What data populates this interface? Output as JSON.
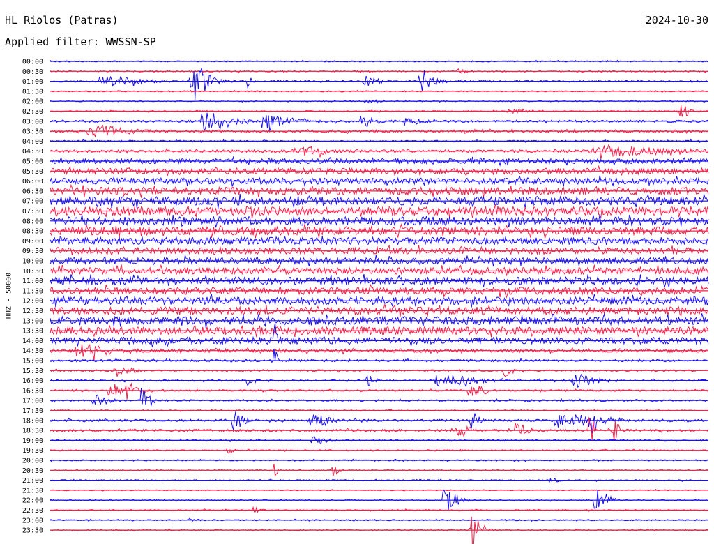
{
  "header": {
    "station": "HL Riolos (Patras)",
    "date": "2024-10-30",
    "filter": "Applied filter: WWSSN-SP"
  },
  "colors": {
    "traceA": "#1a10f0",
    "traceB": "#f0204a",
    "text": "#000000"
  },
  "chart_data": {
    "type": "line",
    "title": "HL Riolos (Patras)",
    "subtitle": "Applied filter: WWSSN-SP",
    "ylabel": "HHZ - 50000",
    "xlabel": "",
    "grid": false,
    "row_labels": [
      "00:00",
      "00:30",
      "01:00",
      "01:30",
      "02:00",
      "02:30",
      "03:00",
      "03:30",
      "04:00",
      "04:30",
      "05:00",
      "05:30",
      "06:00",
      "06:30",
      "07:00",
      "07:30",
      "08:00",
      "08:30",
      "09:00",
      "09:30",
      "10:00",
      "10:30",
      "11:00",
      "11:30",
      "12:00",
      "12:30",
      "13:00",
      "13:30",
      "14:00",
      "14:30",
      "15:00",
      "15:30",
      "16:00",
      "16:30",
      "17:00",
      "17:30",
      "18:00",
      "18:30",
      "19:00",
      "19:30",
      "20:00",
      "20:30",
      "21:00",
      "21:30",
      "22:00",
      "22:30",
      "23:00",
      "23:30"
    ],
    "series": [
      {
        "color": "blue",
        "rows": [
          0,
          2,
          4,
          6,
          8,
          10,
          12,
          14,
          16,
          18,
          20,
          22,
          24,
          26,
          28,
          30,
          32,
          34,
          36,
          38,
          40,
          42,
          44,
          46
        ]
      },
      {
        "color": "red",
        "rows": [
          1,
          3,
          5,
          7,
          9,
          11,
          13,
          15,
          17,
          19,
          21,
          23,
          25,
          27,
          29,
          31,
          33,
          35,
          37,
          39,
          41,
          43,
          45,
          47
        ]
      }
    ],
    "noise_level": [
      0.15,
      0.15,
      0.2,
      0.15,
      0.12,
      0.15,
      0.25,
      0.3,
      0.2,
      0.3,
      0.55,
      0.65,
      0.7,
      0.85,
      0.95,
      0.95,
      0.95,
      0.9,
      0.8,
      0.7,
      0.7,
      0.75,
      0.85,
      0.8,
      0.85,
      0.85,
      0.9,
      0.85,
      0.75,
      0.4,
      0.25,
      0.2,
      0.2,
      0.2,
      0.2,
      0.15,
      0.25,
      0.25,
      0.2,
      0.15,
      0.15,
      0.15,
      0.15,
      0.12,
      0.15,
      0.15,
      0.15,
      0.15
    ],
    "events": [
      {
        "row": 1,
        "t": 0.62,
        "amp": 0.2,
        "width": 0.01
      },
      {
        "row": 2,
        "t": 0.09,
        "amp": 0.4,
        "width": 0.05
      },
      {
        "row": 2,
        "t": 0.22,
        "amp": 0.45,
        "width": 0.02
      },
      {
        "row": 2,
        "t": 0.3,
        "amp": 1.4,
        "width": 0.004
      },
      {
        "row": 2,
        "t": 0.22,
        "amp": 0.6,
        "width": 0.03
      },
      {
        "row": 2,
        "t": 0.48,
        "amp": 0.45,
        "width": 0.02
      },
      {
        "row": 2,
        "t": 0.565,
        "amp": 0.6,
        "width": 0.025
      },
      {
        "row": 4,
        "t": 0.48,
        "amp": 0.15,
        "width": 0.02
      },
      {
        "row": 5,
        "t": 0.7,
        "amp": 0.2,
        "width": 0.02
      },
      {
        "row": 5,
        "t": 0.96,
        "amp": 0.55,
        "width": 0.015
      },
      {
        "row": 6,
        "t": 0.24,
        "amp": 0.8,
        "width": 0.04
      },
      {
        "row": 6,
        "t": 0.33,
        "amp": 0.7,
        "width": 0.035
      },
      {
        "row": 6,
        "t": 0.475,
        "amp": 0.5,
        "width": 0.02
      },
      {
        "row": 6,
        "t": 0.54,
        "amp": 0.4,
        "width": 0.025
      },
      {
        "row": 7,
        "t": 0.07,
        "amp": 0.5,
        "width": 0.05
      },
      {
        "row": 9,
        "t": 0.38,
        "amp": 0.4,
        "width": 0.04
      },
      {
        "row": 9,
        "t": 0.85,
        "amp": 0.4,
        "width": 0.1
      },
      {
        "row": 28,
        "t": 0.34,
        "amp": 1.8,
        "width": 0.004
      },
      {
        "row": 29,
        "t": 0.05,
        "amp": 0.5,
        "width": 0.04
      },
      {
        "row": 30,
        "t": 0.34,
        "amp": 2.2,
        "width": 0.004
      },
      {
        "row": 31,
        "t": 0.1,
        "amp": 0.3,
        "width": 0.03
      },
      {
        "row": 31,
        "t": 0.69,
        "amp": 0.7,
        "width": 0.01
      },
      {
        "row": 32,
        "t": 0.3,
        "amp": 0.5,
        "width": 0.01
      },
      {
        "row": 32,
        "t": 0.48,
        "amp": 0.6,
        "width": 0.01
      },
      {
        "row": 32,
        "t": 0.6,
        "amp": 0.5,
        "width": 0.05
      },
      {
        "row": 32,
        "t": 0.8,
        "amp": 0.6,
        "width": 0.03
      },
      {
        "row": 33,
        "t": 0.1,
        "amp": 0.5,
        "width": 0.04
      },
      {
        "row": 33,
        "t": 0.64,
        "amp": 0.6,
        "width": 0.02
      },
      {
        "row": 34,
        "t": 0.07,
        "amp": 0.5,
        "width": 0.02
      },
      {
        "row": 34,
        "t": 0.14,
        "amp": 1.4,
        "width": 0.01
      },
      {
        "row": 36,
        "t": 0.28,
        "amp": 0.9,
        "width": 0.015
      },
      {
        "row": 36,
        "t": 0.4,
        "amp": 0.6,
        "width": 0.025
      },
      {
        "row": 36,
        "t": 0.64,
        "amp": 1.1,
        "width": 0.01
      },
      {
        "row": 36,
        "t": 0.78,
        "amp": 0.6,
        "width": 0.05
      },
      {
        "row": 36,
        "t": 0.82,
        "amp": 1.1,
        "width": 0.008
      },
      {
        "row": 37,
        "t": 0.62,
        "amp": 0.7,
        "width": 0.015
      },
      {
        "row": 37,
        "t": 0.71,
        "amp": 0.7,
        "width": 0.015
      },
      {
        "row": 37,
        "t": 0.82,
        "amp": 1.8,
        "width": 0.006
      },
      {
        "row": 37,
        "t": 0.855,
        "amp": 1.0,
        "width": 0.01
      },
      {
        "row": 38,
        "t": 0.4,
        "amp": 0.3,
        "width": 0.02
      },
      {
        "row": 39,
        "t": 0.27,
        "amp": 0.3,
        "width": 0.01
      },
      {
        "row": 41,
        "t": 0.34,
        "amp": 0.9,
        "width": 0.005
      },
      {
        "row": 41,
        "t": 0.43,
        "amp": 0.5,
        "width": 0.01
      },
      {
        "row": 42,
        "t": 0.76,
        "amp": 0.3,
        "width": 0.01
      },
      {
        "row": 44,
        "t": 0.6,
        "amp": 1.0,
        "width": 0.02
      },
      {
        "row": 44,
        "t": 0.83,
        "amp": 1.0,
        "width": 0.02
      },
      {
        "row": 45,
        "t": 0.31,
        "amp": 0.25,
        "width": 0.01
      },
      {
        "row": 46,
        "t": 0.21,
        "amp": 0.3,
        "width": 0.005
      },
      {
        "row": 47,
        "t": 0.64,
        "amp": 2.2,
        "width": 0.015
      }
    ]
  }
}
